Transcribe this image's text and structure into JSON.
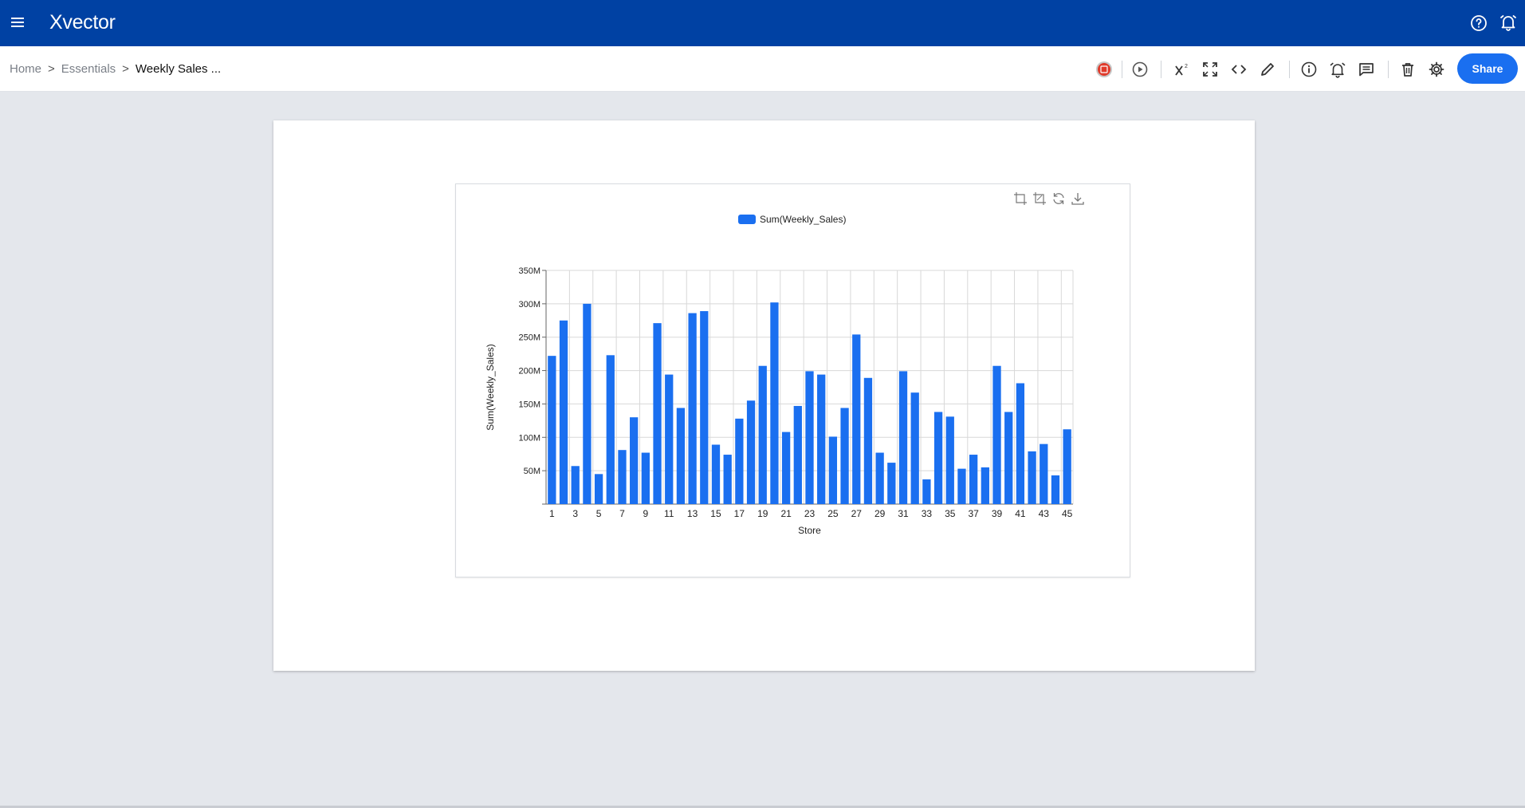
{
  "app": {
    "logo": "Xvector"
  },
  "topbar": {
    "icons": [
      "menu-icon",
      "help-icon",
      "alarm-bell-icon"
    ]
  },
  "breadcrumb": {
    "home": "Home",
    "sep": ">",
    "section": "Essentials",
    "current": "Weekly Sales ..."
  },
  "toolbar": {
    "icons": [
      "record-icon",
      "play-icon",
      "superscript-x-icon",
      "fullscreen-icon",
      "code-icon",
      "pencil-icon",
      "info-icon",
      "alarm-icon",
      "comment-icon",
      "trash-icon",
      "gear-icon"
    ],
    "share_label": "Share"
  },
  "chart_controls": [
    "crop-icon",
    "crop-reset-icon",
    "refresh-icon",
    "download-icon"
  ],
  "colors": {
    "brand": "#0041a3",
    "accent": "#1a6ff0",
    "bar": "#1a6ff0"
  },
  "chart_data": {
    "type": "bar",
    "legend": "Sum(Weekly_Sales)",
    "legend_position": "top-center",
    "xlabel": "Store",
    "ylabel": "Sum(Weekly_Sales)",
    "ylim": [
      0,
      350000000
    ],
    "yticks": [
      0,
      50000000,
      100000000,
      150000000,
      200000000,
      250000000,
      300000000,
      350000000
    ],
    "ytick_labels": [
      "",
      "50M",
      "100M",
      "150M",
      "200M",
      "250M",
      "300M",
      "350M"
    ],
    "grid": true,
    "categories": [
      1,
      2,
      3,
      4,
      5,
      6,
      7,
      8,
      9,
      10,
      11,
      12,
      13,
      14,
      15,
      16,
      17,
      18,
      19,
      20,
      21,
      22,
      23,
      24,
      25,
      26,
      27,
      28,
      29,
      30,
      31,
      32,
      33,
      34,
      35,
      36,
      37,
      38,
      39,
      40,
      41,
      42,
      43,
      44,
      45
    ],
    "xtick_labels": [
      "1",
      "3",
      "5",
      "7",
      "9",
      "11",
      "13",
      "15",
      "17",
      "19",
      "21",
      "23",
      "25",
      "27",
      "29",
      "31",
      "33",
      "35",
      "37",
      "39",
      "41",
      "43",
      "45"
    ],
    "values": [
      222,
      275,
      57,
      300,
      45,
      223,
      81,
      130,
      77,
      271,
      194,
      144,
      286,
      289,
      89,
      74,
      128,
      155,
      207,
      302,
      108,
      147,
      199,
      194,
      101,
      144,
      254,
      189,
      77,
      62,
      199,
      167,
      37,
      138,
      131,
      53,
      74,
      55,
      207,
      138,
      181,
      79,
      90,
      43,
      112
    ],
    "value_units": "M"
  }
}
